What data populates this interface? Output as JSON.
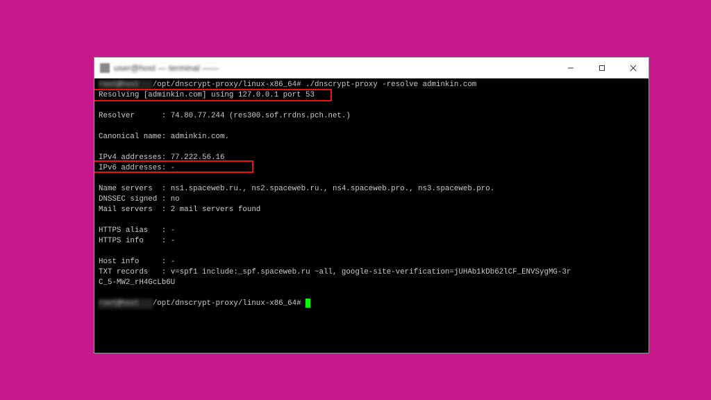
{
  "window": {
    "title_blurred": "user@host — terminal ——",
    "controls": {
      "min": "—",
      "max": "▢",
      "close": "✕"
    }
  },
  "term": {
    "user_blur": "root@host   ",
    "path": "/opt/dnscrypt-proxy/linux-x86_64#",
    "cmd": "./dnscrypt-proxy -resolve adminkin.com",
    "resolving": "Resolving [adminkin.com] using 127.0.0.1 port 53",
    "resolver_label": "Resolver      :",
    "resolver_value": "74.80.77.244 (res300.sof.rrdns.pch.net.)",
    "canon_label": "Canonical name:",
    "canon_value": "adminkin.com.",
    "ipv4_label": "IPv4 addresses:",
    "ipv4_value": "77.222.56.16",
    "ipv6_label": "IPv6 addresses:",
    "ipv6_value": "-",
    "ns_label": "Name servers  :",
    "ns_value": "ns1.spaceweb.ru., ns2.spaceweb.ru., ns4.spaceweb.pro., ns3.spaceweb.pro.",
    "dnssec_label": "DNSSEC signed :",
    "dnssec_value": "no",
    "mail_label": "Mail servers  :",
    "mail_value": "2 mail servers found",
    "halias_label": "HTTPS alias   :",
    "halias_value": "-",
    "hinfo_label": "HTTPS info    :",
    "hinfo_value": "-",
    "hostinfo_label": "Host info     :",
    "hostinfo_value": "-",
    "txt_label": "TXT records   :",
    "txt_value": "v=spf1 include:_spf.spaceweb.ru ~all, google-site-verification=jUHAb1kDb62lCF_ENVSygMG-3r",
    "txt_wrap": "C_5-MW2_rH4GcLb6U"
  }
}
